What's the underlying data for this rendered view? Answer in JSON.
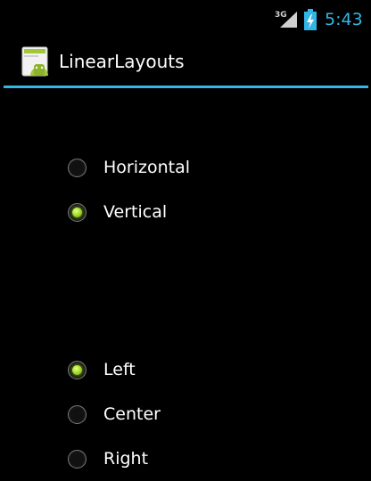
{
  "status_bar": {
    "network_label": "3G",
    "time": "5:43",
    "signal_icon": "signal-icon",
    "battery_icon": "battery-charging-icon",
    "accent_color": "#33b5e5"
  },
  "action_bar": {
    "title": "LinearLayouts",
    "icon": "android-app-icon",
    "divider_color": "#33b5e5"
  },
  "orientation_group": {
    "options": [
      {
        "label": "Horizontal",
        "checked": false
      },
      {
        "label": "Vertical",
        "checked": true
      }
    ]
  },
  "gravity_group": {
    "options": [
      {
        "label": "Left",
        "checked": true
      },
      {
        "label": "Center",
        "checked": false
      },
      {
        "label": "Right",
        "checked": false
      }
    ]
  },
  "colors": {
    "radio_checked": "#a6e22e",
    "background": "#000000"
  }
}
